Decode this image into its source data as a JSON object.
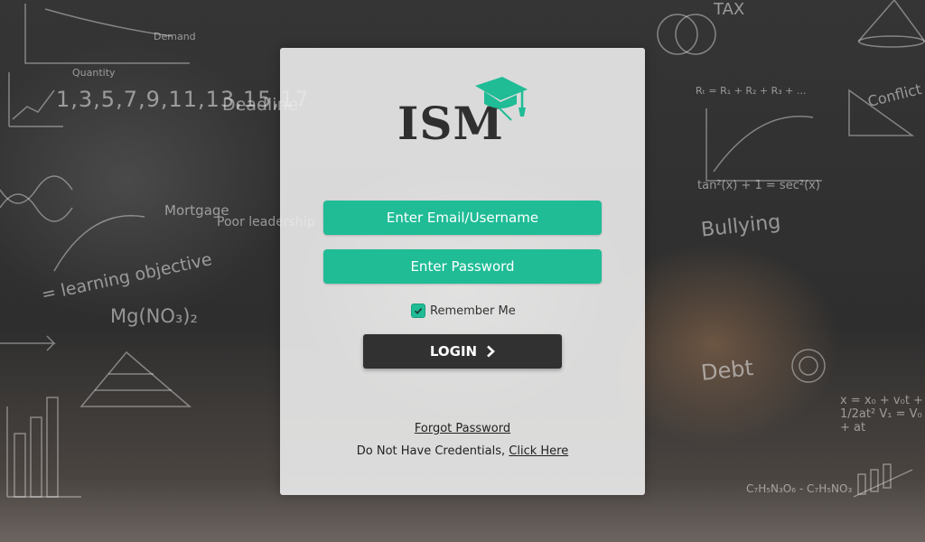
{
  "background": {
    "sequence": "1,3,5,7,9,11,13,15,17",
    "deadline": "Deadline",
    "mortgage": "Mortgage",
    "poor_leadership": "Poor leadership",
    "learning_objective": "= learning objective",
    "formula_mg": "Mg(NO₃)₂",
    "demand": "Demand",
    "quantity": "Quantity",
    "tax": "TAX",
    "conflict": "Conflict",
    "tan_formula": "tan²(x) + 1 = sec²(x)",
    "bullying": "Bullying",
    "debt": "Debt",
    "kinematics": "x = x₀ + v₀t + 1/2at²  V₁ = V₀ + at",
    "chemistry": "C₇H₅N₃O₆ - C₇H₅NO₃",
    "resistors": "Rₜ = R₁ + R₂ + R₃ + ..."
  },
  "logo": {
    "text": "ISM",
    "accent_color": "#1fbc96",
    "icon": "graduation-cap-icon"
  },
  "form": {
    "email_placeholder": "Enter Email/Username",
    "password_placeholder": "Enter Password",
    "remember_label": "Remember Me",
    "remember_checked": true,
    "login_label": "LOGIN",
    "login_icon": "chevron-right-icon",
    "forgot_label": "Forgot Password",
    "credentials_text": "Do Not Have Credentials,",
    "credentials_link": "Click Here"
  },
  "colors": {
    "field_bg": "#1fbc96",
    "button_bg": "#313131",
    "card_bg": "#ececec"
  }
}
